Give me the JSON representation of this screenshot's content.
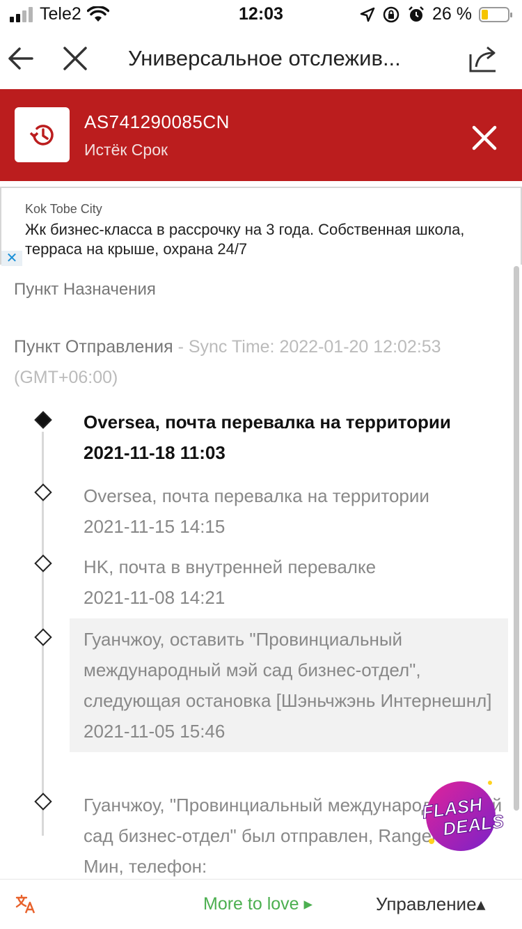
{
  "status_bar": {
    "carrier": "Tele2",
    "time": "12:03",
    "battery_percent": "26 %",
    "battery_level": 0.26,
    "icons": [
      "signal-icon",
      "wifi-icon",
      "location-icon",
      "rotation-lock-icon",
      "alarm-icon",
      "battery-icon"
    ]
  },
  "nav": {
    "title": "Универсальное отслежив..."
  },
  "banner": {
    "tracking_number": "AS741290085CN",
    "status": "Истёк Срок"
  },
  "ad": {
    "source": "Kok Tobe City",
    "text": "Жк бизнес-класса в рассрочку на 3 года. Собственная школа, терраса на крыше, охрана 24/7",
    "close": "✕"
  },
  "tracking": {
    "destination_label": "Пункт Назначения",
    "origin_label": "Пункт Отправления",
    "sync_text": " - Sync Time: 2022-01-20 12:02:53 (GMT+06:00)",
    "events": [
      {
        "description": "Oversea, почта перевалка на территории",
        "time": "2021-11-18 11:03"
      },
      {
        "description": "Oversea, почта перевалка на территории",
        "time": "2021-11-15 14:15"
      },
      {
        "description": "HK, почта в внутренней перевалке",
        "time": "2021-11-08 14:21"
      },
      {
        "description": "Гуанчжоу, оставить \"Провинциальный международный мэй сад бизнес-отдел\", следующая остановка [Шэньчжэнь Интернешнл]",
        "time": "2021-11-05 15:46"
      },
      {
        "description": "Гуанчжоу, \"Провинциальный международный мэй сад бизнес-отдел\" был отправлен, Ranger: Пэн Мин, телефон:",
        "time": ""
      }
    ]
  },
  "flash_deals": {
    "line1": "FLASH",
    "line2": "DEALS"
  },
  "bottom": {
    "more_to_love": "More to love ▸",
    "manage": "Управление▴"
  },
  "colors": {
    "banner_red": "#bb1d1e",
    "more_to_love_green": "#4caf50",
    "flash_purple": "#9b27c9",
    "flash_pink": "#e0239a"
  }
}
